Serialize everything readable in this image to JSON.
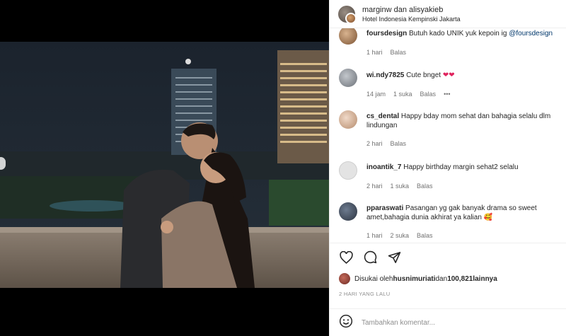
{
  "header": {
    "accounts": "marginw dan alisyakieb",
    "location": "Hotel Indonesia Kempinski Jakarta"
  },
  "comments": [
    {
      "user": "foursdesign",
      "text": "Butuh kado UNIK yuk kepoin ig ",
      "mention": "@foursdesign",
      "time": "1 hari",
      "likes": "",
      "reply": "Balas"
    },
    {
      "user": "wi.ndy7825",
      "text": "Cute bnget",
      "emoji": "❤❤",
      "time": "14 jam",
      "likes": "1 suka",
      "reply": "Balas",
      "more": "•••"
    },
    {
      "user": "cs_dental",
      "text": "Happy bday mom sehat dan bahagia selalu dlm lindungan",
      "time": "2 hari",
      "likes": "",
      "reply": "Balas"
    },
    {
      "user": "inoantik_7",
      "text": "Happy birthday margin sehat2 selalu",
      "time": "2 hari",
      "likes": "1 suka",
      "reply": "Balas"
    },
    {
      "user": "pparaswati",
      "text": "Pasangan yg gak banyak drama so sweet amet,bahagia dunia akhirat ya kalian ",
      "emoji": "🥰",
      "time": "1 hari",
      "likes": "2 suka",
      "reply": "Balas"
    }
  ],
  "likes": {
    "prefix": "Disukai oleh ",
    "user": "husnimuriati",
    "middle": " dan ",
    "count": "100,821",
    "suffix": " lainnya"
  },
  "timestamp": "2 HARI YANG LALU",
  "add_comment": {
    "placeholder": "Tambahkan komentar..."
  },
  "icons": {
    "like": "heart-icon",
    "comment": "comment-icon",
    "share": "share-icon",
    "emoji": "smiley-icon"
  },
  "colors": {
    "accent_heart": "#e0245e",
    "meta": "#737373",
    "mention": "#00376b"
  }
}
